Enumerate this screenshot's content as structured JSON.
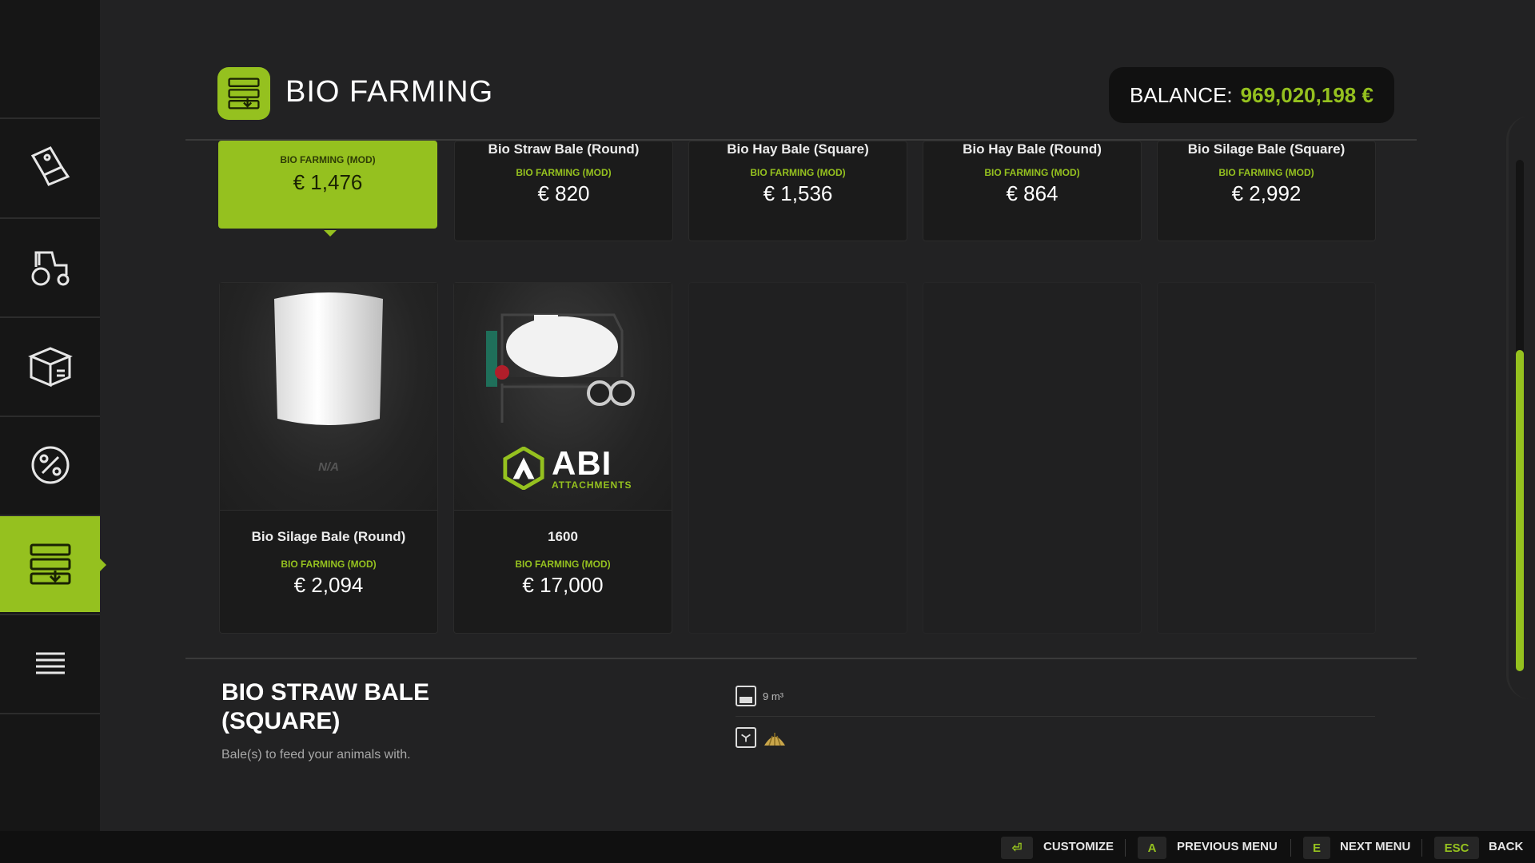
{
  "header": {
    "title": "BIO FARMING",
    "balance_label": "BALANCE:",
    "balance_value": "969,020,198 €"
  },
  "sidebar": {
    "items": [
      {
        "icon": "shop-tag-icon",
        "active": false
      },
      {
        "icon": "tractor-icon",
        "active": false
      },
      {
        "icon": "crate-icon",
        "active": false
      },
      {
        "icon": "percent-gear-icon",
        "active": false
      },
      {
        "icon": "shelves-icon",
        "active": true
      },
      {
        "icon": "list-icon",
        "active": false
      }
    ]
  },
  "cards_row1": [
    {
      "name": "",
      "mod": "BIO FARMING (MOD)",
      "price": "€ 1,476",
      "selected": true
    },
    {
      "name": "Bio Straw Bale (Round)",
      "mod": "BIO FARMING (MOD)",
      "price": "€ 820"
    },
    {
      "name": "Bio Hay Bale (Square)",
      "mod": "BIO FARMING (MOD)",
      "price": "€ 1,536"
    },
    {
      "name": "Bio Hay Bale (Round)",
      "mod": "BIO FARMING (MOD)",
      "price": "€ 864"
    },
    {
      "name": "Bio Silage Bale (Square)",
      "mod": "BIO FARMING (MOD)",
      "price": "€ 2,992"
    }
  ],
  "cards_row2": [
    {
      "name": "Bio Silage Bale (Round)",
      "mod": "BIO FARMING (MOD)",
      "price": "€ 2,094",
      "brand": "N/A"
    },
    {
      "name": "1600",
      "mod": "BIO FARMING (MOD)",
      "price": "€ 17,000",
      "brand_name": "ABI",
      "brand_sub": "ATTACHMENTS"
    }
  ],
  "detail": {
    "title": "BIO STRAW BALE (SQUARE)",
    "description": "Bale(s) to feed your animals with.",
    "capacity": "9 m³"
  },
  "footer": [
    {
      "key": "⏎",
      "label": "CUSTOMIZE"
    },
    {
      "key": "A",
      "label": "PREVIOUS MENU"
    },
    {
      "key": "E",
      "label": "NEXT MENU"
    },
    {
      "key": "ESC",
      "label": "BACK"
    }
  ],
  "colors": {
    "accent": "#95c11f",
    "background": "#222223",
    "sidebar": "#161616"
  }
}
